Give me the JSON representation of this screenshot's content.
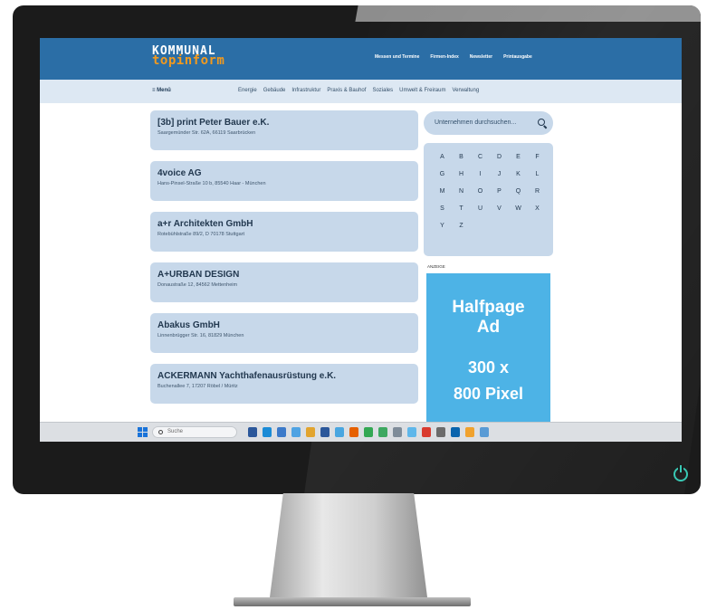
{
  "site": {
    "logo_line1": "KOMMUNAL",
    "logo_line2": "topinform",
    "top_links": [
      "Messen und Termine",
      "Firmen-Index",
      "Newsletter",
      "Printausgabe"
    ],
    "menu_label": "≡  Menü",
    "nav": [
      "Energie",
      "Gebäude",
      "Infrastruktur",
      "Praxis & Bauhof",
      "Soziales",
      "Umwelt & Freiraum",
      "Verwaltung"
    ]
  },
  "companies": [
    {
      "name": "[3b] print Peter Bauer e.K.",
      "address": "Saargemünder Str. 62A, 66119 Saarbrücken"
    },
    {
      "name": "4voice AG",
      "address": "Hans-Pinsel-Straße 10 b, 85540 Haar - München"
    },
    {
      "name": "a+r Architekten GmbH",
      "address": "Rotebühlstraße 89/2, D 70178 Stuttgart"
    },
    {
      "name": "A+URBAN DESIGN",
      "address": "Donaustraße 12, 84562 Mettenheim"
    },
    {
      "name": "Abakus GmbH",
      "address": "Linnenbrügger Str. 16, 81829 München"
    },
    {
      "name": "ACKERMANN Yachthafenausrüstung e.K.",
      "address": "Buchenallee 7, 17207 Röbel / Müritz"
    }
  ],
  "sidebar": {
    "search_placeholder": "Unternehmen durchsuchen...",
    "letters": [
      "A",
      "B",
      "C",
      "D",
      "E",
      "F",
      "G",
      "H",
      "I",
      "J",
      "K",
      "L",
      "M",
      "N",
      "O",
      "P",
      "Q",
      "R",
      "S",
      "T",
      "U",
      "V",
      "W",
      "X",
      "Y",
      "Z"
    ],
    "ad_label": "ANZEIGE",
    "ad_line1": "Halfpage",
    "ad_line2": "Ad",
    "ad_line3": "300 x",
    "ad_line4": "800 Pixel"
  },
  "taskbar": {
    "search_placeholder": "Suche",
    "app_icons": [
      "file-explorer-icon",
      "edge-icon",
      "mail-icon",
      "store-icon",
      "folder-icon",
      "word-icon",
      "browser-icon",
      "firefox-icon",
      "chrome-icon",
      "photos-icon",
      "calc-icon",
      "paint-icon",
      "acrobat-icon",
      "settings-icon",
      "outlook-icon",
      "notes-icon",
      "files-icon"
    ],
    "icon_colors": [
      "#2b579a",
      "#1a8bd6",
      "#3c7ac9",
      "#4fa3e3",
      "#e2a42e",
      "#2b579a",
      "#4aa6e0",
      "#e66000",
      "#34a853",
      "#3da860",
      "#7f8c99",
      "#5fb7ea",
      "#d93b2f",
      "#6b6b6b",
      "#0a64ad",
      "#f0a22e",
      "#5a9bd5"
    ]
  },
  "colors": {
    "header": "#2b6ea6",
    "card": "#c7d8ea",
    "ad": "#4db3e6",
    "logo_accent": "#f39a1d",
    "power_led": "#39c8b4"
  }
}
